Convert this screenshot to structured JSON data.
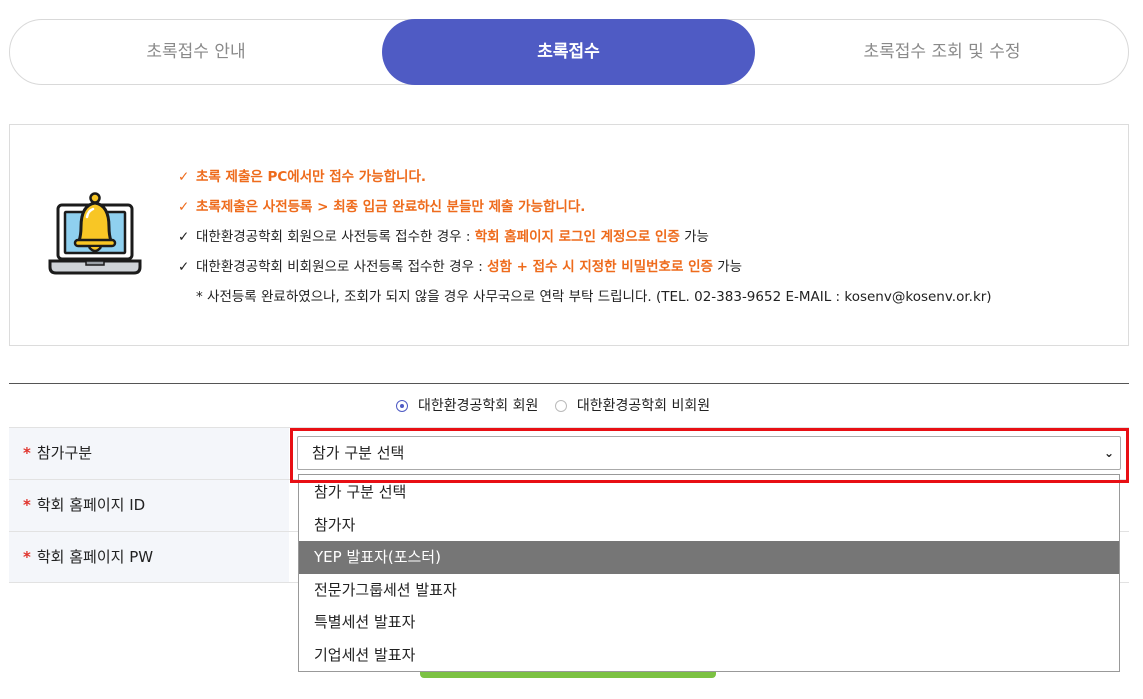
{
  "tabs": [
    {
      "label": "초록접수 안내",
      "active": false
    },
    {
      "label": "초록접수",
      "active": true
    },
    {
      "label": "초록접수 조회 및 수정",
      "active": false
    }
  ],
  "notice": {
    "icon": "laptop-bell-icon",
    "line1": "초록 제출은 PC에서만 접수 가능합니다.",
    "line2": "초록제출은 사전등록 > 최종 입금 완료하신 분들만 제출 가능합니다.",
    "line3_a": "대한환경공학회 회원으로 사전등록 접수한 경우 : ",
    "line3_b": "학회 홈페이지 로그인 계정으로 인증",
    "line3_c": " 가능",
    "line4_a": "대한환경공학회 비회원으로 사전등록 접수한 경우 : ",
    "line4_b": "성함 + 접수 시 지정한 비밀번호로 인증",
    "line4_c": " 가능",
    "note": "*  사전등록 완료하였으나, 조회가 되지 않을 경우 사무국으로 연락 부탁 드립니다. (TEL. 02-383-9652 E-MAIL : kosenv@kosenv.or.kr)",
    "check_mark": "✓"
  },
  "membership": {
    "options": [
      "대한환경공학회 회원",
      "대한환경공학회 비회원"
    ],
    "selected": "대한환경공학회 회원"
  },
  "form": {
    "required_mark": "*",
    "category_label": "참가구분",
    "id_label": "학회 홈페이지 ID",
    "pw_label": "학회 홈페이지 PW"
  },
  "category_select": {
    "value": "참가 구분 선택",
    "options": [
      "참가 구분 선택",
      "참가자",
      "YEP 발표자(포스터)",
      "전문가그룹세션 발표자",
      "특별세션 발표자",
      "기업세션 발표자"
    ],
    "highlighted": "YEP 발표자(포스터)"
  },
  "colors": {
    "accent": "#4f5bc4",
    "notice_orange": "#ee6b1c",
    "required_red": "#e0322b",
    "highlight_box": "#e80f14",
    "submit_green": "#7cc243"
  }
}
